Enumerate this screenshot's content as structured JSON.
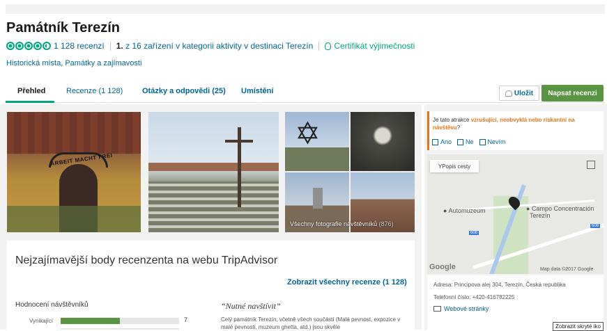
{
  "header": {
    "title": "Památník Terezín",
    "reviews_count": "1 128 recenzí",
    "rank_number": "1.",
    "rank_text": "z 16 zařízení v kategorii aktivity v destinaci Terezín",
    "certificate": "Certifikát výjimečnosti",
    "category": "Historická místa, Památky a zajímavosti",
    "rating_bubbles": 4.5
  },
  "tabs": [
    {
      "label": "Přehled"
    },
    {
      "label": "Recenze (1 128)"
    },
    {
      "label": "Otázky a odpovědi (25)"
    },
    {
      "label": "Umístění"
    }
  ],
  "actions": {
    "save": "Uložit",
    "write_review": "Napsat recenzi"
  },
  "gallery": {
    "photo1_sign": "ARBEIT MACHT FREI",
    "all_photos": "Všechny fotografie návštěvníků",
    "all_photos_count": "(876)"
  },
  "highlights": {
    "title": "Nejzajímavější body recenzenta na webu TripAdvisor",
    "show_all": "Zobrazit všechny recenze (1 128)",
    "ratings_heading": "Hodnocení návštěvníků",
    "rating_label": "Vynikající",
    "rating_count": "7",
    "rating_fill_fraction": 0.5,
    "quote": "“Nutné navštívit”",
    "review_text": "Celý památník Terezín, včetně všech součástí (Malá pevnost, expozice v malé pevnosti, muzeum ghetta, atd.) jsou skvěle"
  },
  "sidebar": {
    "question_prefix": "Je tato atrakce",
    "question_highlight": "vzrušující, neobvyklá nebo riskantní na návštěvu",
    "question_suffix": "?",
    "options": [
      "Ano",
      "Ne",
      "Nevím"
    ],
    "map_button": "Popis cesty",
    "poi_automuzeum": "Automuzeum",
    "poi_campo_line1": "Campo Concentración",
    "poi_campo_line2": "Terezín",
    "google": "Google",
    "map_data": "Map data ©2017 Google",
    "road_shield": "608",
    "address": "Adresa: Principova alej 304, Terezín, Česká republika",
    "phone": "Telefonní číslo: +420-416782225",
    "website": "Webové stránky",
    "tooltip": "Zobrazit skryté iko"
  },
  "colors": {
    "accent_green": "#00a680",
    "button_green": "#589442",
    "link_blue": "#006699",
    "question_orange": "#e8731a"
  }
}
